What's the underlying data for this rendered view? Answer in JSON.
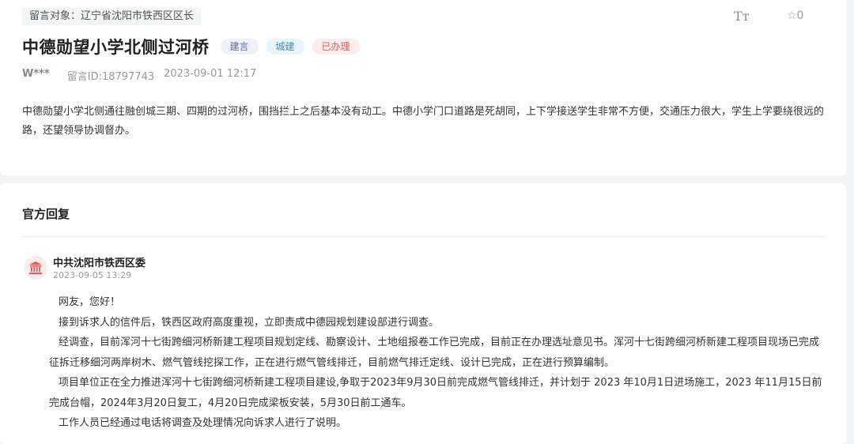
{
  "message": {
    "target_label": "留言对象：辽宁省沈阳市铁西区区长",
    "font_toggle": "Tт",
    "favorite_count": "☆0",
    "title": "中德勋望小学北侧过河桥",
    "badges": {
      "type": "建言",
      "category": "城建",
      "status": "已办理"
    },
    "author": "W***",
    "message_id": "留言ID:18797743",
    "time": "2023-09-01 12:17",
    "content": "中德勋望小学北侧通往融创城三期、四期的过河桥，围挡拦上之后基本没有动工。中德小学门口道路是死胡同，上下学接送学生非常不方便，交通压力很大，学生上学要绕很远的路，还望领导协调督办。"
  },
  "reply": {
    "heading": "官方回复",
    "org_name": "中共沈阳市铁西区委",
    "org_icon": "government-building-icon",
    "time": "2023-09-05 13:29",
    "paragraphs": [
      "网友，您好！",
      "接到诉求人的信件后，铁西区政府高度重视，立即责成中德园规划建设部进行调查。",
      "经调查，目前浑河十七街跨细河桥新建工程项目规划定线、勘察设计、土地组报卷工作已完成，目前正在办理选址意见书。浑河十七街跨细河桥新建工程项目现场已完成征拆迁移细河两岸树木、燃气管线挖探工作，正在进行燃气管线排迁，目前燃气排迁定线、设计已完成，正在进行预算编制。",
      "项目单位正在全力推进浑河十七街跨细河桥新建工程项目建设,争取于2023年9月30日前完成燃气管线排迁，并计划于 2023 年10月1日进场施工，2023 年11月15日前完成台帽，2024年3月20日复工，4月20日完成梁板安装，5月30日前工通车。",
      "工作人员已经通过电话将调查及处理情况向诉求人进行了说明。"
    ]
  },
  "colors": {
    "status_red": "#e45a5a",
    "category_blue": "#3f8fc9",
    "type_blue": "#5a6f9e",
    "background": "#f3f4f6"
  }
}
